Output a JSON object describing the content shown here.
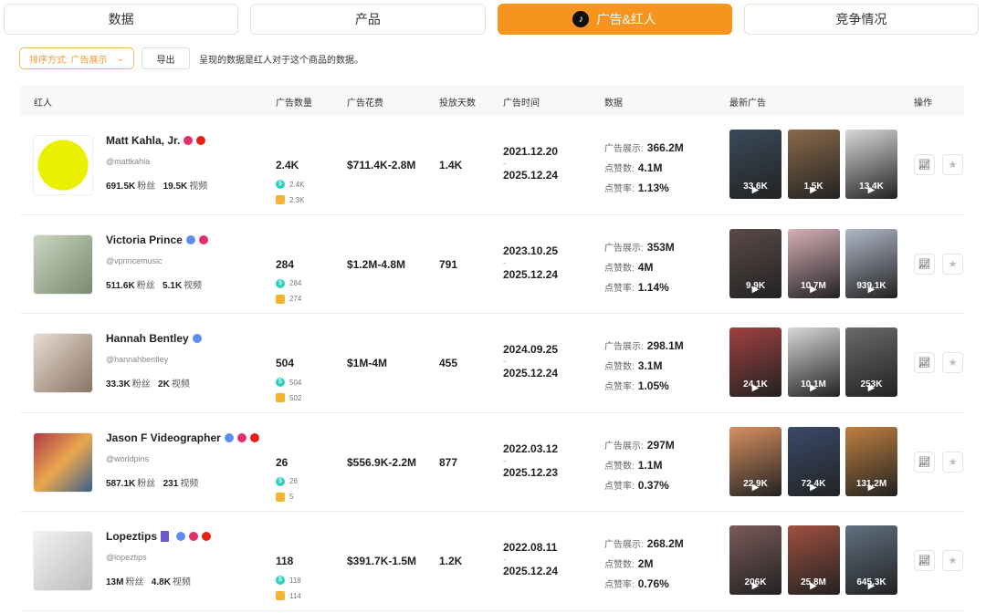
{
  "tabs": [
    "数据",
    "产品",
    "广告&红人",
    "竞争情况"
  ],
  "toolbar": {
    "sort": "排序方式: 广告展示",
    "export": "导出",
    "note": "呈现的数据是红人对于这个商品的数据。"
  },
  "headers": [
    "红人",
    "广告数量",
    "广告花费",
    "投放天数",
    "广告时间",
    "数据",
    "最新广告",
    "操作"
  ],
  "labels": {
    "fans": "粉丝",
    "videos": "视频",
    "impr": "广告展示:",
    "likes": "点赞数:",
    "rate": "点赞率:",
    "dash": "-"
  },
  "rows": [
    {
      "name": "Matt Kahla, Jr.",
      "platforms": [
        "instagram",
        "youtube"
      ],
      "handle": "@mattkahla",
      "fans": "691.5K",
      "videos": "19.5K",
      "ads": "2.4K",
      "ads_a": "2.4K",
      "ads_b": "2.3K",
      "spend": "$711.4K-2.8M",
      "days": "1.4K",
      "start": "2021.12.20",
      "end": "2025.12.24",
      "impr": "366.2M",
      "likes": "4.1M",
      "rate": "1.13%",
      "thumbs": [
        "33.6K",
        "1.5K",
        "13.4K"
      ]
    },
    {
      "name": "Victoria Prince",
      "platforms": [
        "email",
        "instagram"
      ],
      "handle": "@vprincemusic",
      "fans": "511.6K",
      "videos": "5.1K",
      "ads": "284",
      "ads_a": "284",
      "ads_b": "274",
      "spend": "$1.2M-4.8M",
      "days": "791",
      "start": "2023.10.25",
      "end": "2025.12.24",
      "impr": "353M",
      "likes": "4M",
      "rate": "1.14%",
      "thumbs": [
        "9.9K",
        "10.7M",
        "939.1K"
      ]
    },
    {
      "name": "Hannah Bentley",
      "platforms": [
        "email"
      ],
      "handle": "@hannahbentley",
      "fans": "33.3K",
      "videos": "2K",
      "ads": "504",
      "ads_a": "504",
      "ads_b": "502",
      "spend": "$1M-4M",
      "days": "455",
      "start": "2024.09.25",
      "end": "2025.12.24",
      "impr": "298.1M",
      "likes": "3.1M",
      "rate": "1.05%",
      "thumbs": [
        "24.1K",
        "10.1M",
        "253K"
      ]
    },
    {
      "name": "Jason F Videographer",
      "platforms": [
        "email",
        "instagram",
        "youtube"
      ],
      "handle": "@worldpins",
      "fans": "587.1K",
      "videos": "231",
      "ads": "26",
      "ads_a": "26",
      "ads_b": "5",
      "spend": "$556.9K-2.2M",
      "days": "877",
      "start": "2022.03.12",
      "end": "2025.12.23",
      "impr": "297M",
      "likes": "1.1M",
      "rate": "0.37%",
      "thumbs": [
        "22.9K",
        "72.4K",
        "131.2M"
      ]
    },
    {
      "name": "Lopeztips",
      "platforms": [
        "flag",
        "email",
        "instagram",
        "youtube"
      ],
      "handle": "@lopeztips",
      "fans": "13M",
      "videos": "4.8K",
      "ads": "118",
      "ads_a": "118",
      "ads_b": "114",
      "spend": "$391.7K-1.5M",
      "days": "1.2K",
      "start": "2022.08.11",
      "end": "2025.12.24",
      "impr": "268.2M",
      "likes": "2M",
      "rate": "0.76%",
      "thumbs": [
        "206K",
        "25.8M",
        "645.3K"
      ]
    }
  ],
  "colors": {
    "accent": "#f7941d",
    "instagram": "#e1306c",
    "youtube": "#e62117",
    "email": "#5b8def",
    "flag": "#6a5acd"
  }
}
